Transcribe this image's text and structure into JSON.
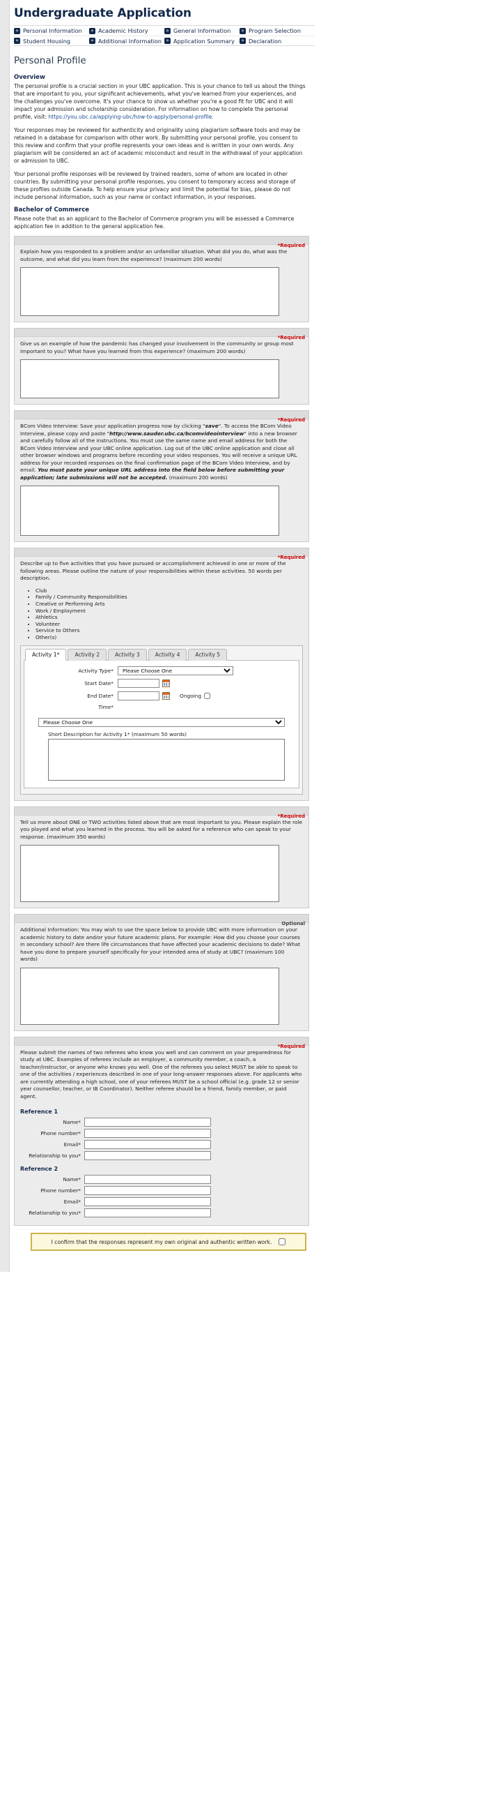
{
  "header": {
    "app_title": "Undergraduate Application",
    "nav_rows": [
      [
        {
          "label": "Personal Information",
          "icon": "chevron-double-right-icon"
        },
        {
          "label": "Academic History",
          "icon": "chevron-double-right-icon"
        },
        {
          "label": "General Information",
          "icon": "chevron-double-right-icon"
        },
        {
          "label": "Program Selection",
          "icon": "chevron-double-right-icon"
        }
      ],
      [
        {
          "label": "Student Housing",
          "icon": "chevron-double-right-icon"
        },
        {
          "label": "Additional Information",
          "icon": "chevron-double-right-icon"
        },
        {
          "label": "Application Summary",
          "icon": "chevron-double-right-icon"
        },
        {
          "label": "Declaration",
          "icon": "chevron-double-right-icon"
        }
      ]
    ]
  },
  "page": {
    "title": "Personal Profile",
    "overview_heading": "Overview",
    "overview_p1": "The personal profile is a crucial section in your UBC application. This is your chance to tell us about the things that are important to you, your significant achievements, what you've learned from your experiences, and the challenges you've overcome. It's your chance to show us whether you're a good fit for UBC and it will impact your admission and scholarship consideration. For information on how to complete the personal profile, visit: ",
    "overview_link": "https://you.ubc.ca/applying-ubc/how-to-apply/personal-profile.",
    "overview_p2": "Your responses may be reviewed for authenticity and originality using plagiarism software tools and may be retained in a database for comparison with other work. By submitting your personal profile, you consent to this review and confirm that your profile represents your own ideas and is written in your own words. Any plagiarism will be considered an act of academic misconduct and result in the withdrawal of your application or admission to UBC.",
    "overview_p3": "Your personal profile responses will be reviewed by trained readers, some of whom are located in other countries. By submitting your personal profile responses, you consent to temporary access and storage of these profiles outside Canada. To help ensure your privacy and limit the potential for bias, please do not include personal information, such as your name or contact information, in your responses.",
    "bcom_heading": "Bachelor of Commerce",
    "bcom_p": "Please note that as an applicant to the Bachelor of Commerce program you will be assessed a Commerce application fee in addition to the general application fee."
  },
  "labels": {
    "required": "*Required",
    "optional": "Optional"
  },
  "questions": [
    {
      "id": "q-problem",
      "required_label": "*Required",
      "required": true,
      "prompt": "Explain how you responded to a problem and/or an unfamiliar situation. What did you do, what was the outcome, and what did you learn from the experience? (maximum 200 words)",
      "value": "",
      "placeholder": ""
    },
    {
      "id": "q-pandemic",
      "required_label": "*Required",
      "required": true,
      "prompt": "Give us an example of how the pandemic has changed your involvement in the community or group most important to you? What have you learned from this experience? (maximum 200 words)",
      "value": "",
      "placeholder": ""
    }
  ],
  "bcom_video": {
    "required_label": "*Required",
    "prompt_part1": "BCom Video Interview: Save your application progress now by clicking \"",
    "save_word": "save",
    "prompt_part2": "\". To access the BCom Video Interview, please copy and paste \"",
    "url": "http://www.sauder.ubc.ca/bcomvideointerview",
    "prompt_part3": "\" into a new browser and carefully follow all of the instructions. You must use the same name and email address for both the BCom Video Interview and your UBC online application. Log out of the UBC online application and close all other browser windows and programs before recording your video responses. You will receive a unique URL address for your recorded responses on the final confirmation page of the BCom Video Interview, and by email. ",
    "bold_italic": "You must paste your unique URL address into the field below before submitting your application; late submissions will not be accepted.",
    "prompt_part4": " (maximum 200 words)",
    "value": ""
  },
  "activities": {
    "required_label": "*Required",
    "prompt": "Describe up to five activities that you have pursued or accomplishment achieved in one or more of the following areas. Please outline the nature of your responsibilities within these activities. 50 words per description.",
    "bullets": [
      "Club",
      "Family / Community Responsibilities",
      "Creative or Performing Arts",
      "Work / Employment",
      "Athletics",
      "Volunteer",
      "Service to Others",
      "Other(s)"
    ],
    "tabs": [
      {
        "label": "Activity 1*",
        "active": true
      },
      {
        "label": "Activity 2",
        "active": false
      },
      {
        "label": "Activity 3",
        "active": false
      },
      {
        "label": "Activity 4",
        "active": false
      },
      {
        "label": "Activity 5",
        "active": false
      }
    ],
    "fields": {
      "activity_type_label": "Activity Type*",
      "activity_type_value": "Please Choose One",
      "start_date_label": "Start Date*",
      "start_date_value": "",
      "end_date_label": "End Date*",
      "end_date_value": "",
      "ongoing_label": "Ongoing",
      "ongoing_checked": false,
      "time_label": "Time*",
      "time_value": "Please Choose One",
      "short_desc_label": "Short Description for Activity 1* (maximum 50 words)",
      "short_desc_value": ""
    },
    "calendar_icon": "calendar-icon"
  },
  "important_activity": {
    "required_label": "*Required",
    "prompt": "Tell us more about ONE or TWO activities listed above that are most important to you. Please explain the role you played and what you learned in the process. You will be asked for a reference who can speak to your response. (maximum 350 words)",
    "value": ""
  },
  "additional_info": {
    "required_label": "Optional",
    "prompt": "Additional Information: You may wish to use the space below to provide UBC with more information on your academic history to date and/or your future academic plans. For example: How did you choose your courses in secondary school? Are there life circumstances that have affected your academic decisions to date? What have you done to prepare yourself specifically for your intended area of study at UBC? (maximum 100 words)",
    "value": ""
  },
  "references": {
    "required_label": "*Required",
    "prompt": "Please submit the names of two referees who know you well and can comment on your preparedness for study at UBC. Examples of referees include an employer, a community member, a coach, a teacher/instructor, or anyone who knows you well. One of the referees you select MUST be able to speak to one of the activities / experiences described in one of your long-answer responses above. For applicants who are currently attending a high school, one of your referees MUST be a school official (e.g. grade 12 or senior year counsellor, teacher, or IB Coordinator). Neither referee should be a friend, family member, or paid agent.",
    "groups": [
      {
        "heading": "Reference 1",
        "fields": [
          {
            "label": "Name*",
            "value": ""
          },
          {
            "label": "Phone number*",
            "value": ""
          },
          {
            "label": "Email*",
            "value": ""
          },
          {
            "label": "Relationship to you*",
            "value": ""
          }
        ]
      },
      {
        "heading": "Reference 2",
        "fields": [
          {
            "label": "Name*",
            "value": ""
          },
          {
            "label": "Phone number*",
            "value": ""
          },
          {
            "label": "Email*",
            "value": ""
          },
          {
            "label": "Relationship to you*",
            "value": ""
          }
        ]
      }
    ]
  },
  "confirm": {
    "text": "I confirm that the responses represent my own original and authentic written work.",
    "checked": false
  },
  "colors": {
    "brand_navy": "#13294b",
    "required_red": "#cc0000",
    "panel_grey": "#ececec",
    "confirm_bg": "#fcf8dd",
    "confirm_border": "#cdb44a"
  }
}
